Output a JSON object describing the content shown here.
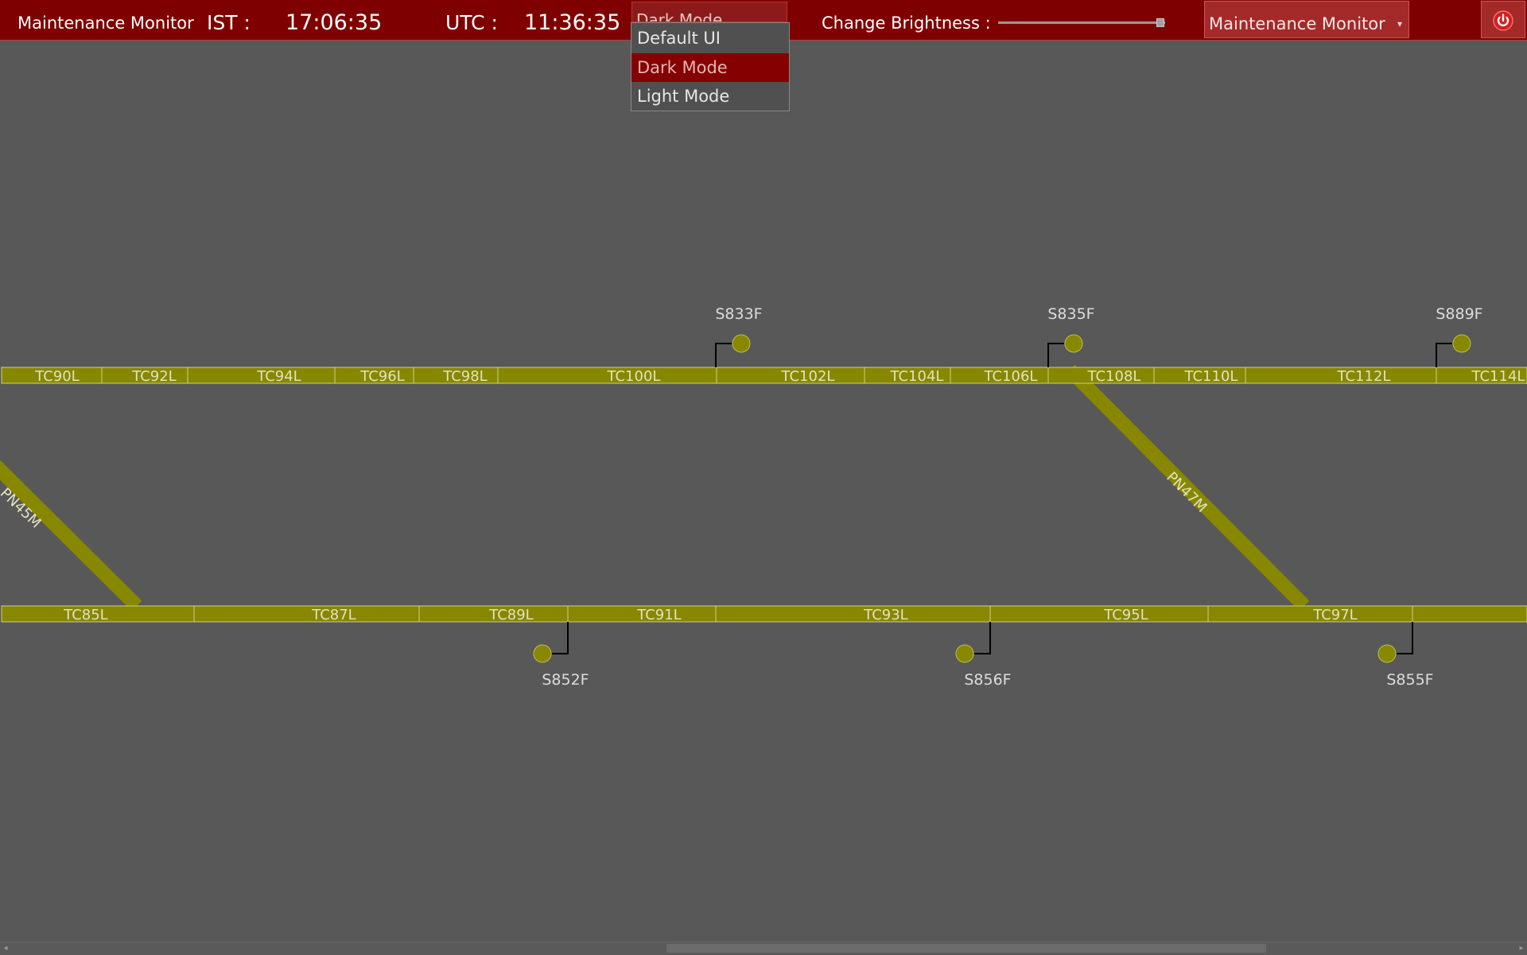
{
  "header": {
    "app_title": "Maintenance Monitor",
    "ist_label": "IST :",
    "ist_time": "17:06:35",
    "utc_label": "UTC :",
    "utc_time": "11:36:35",
    "mode_selected": "Dark Mode",
    "brightness_label": "Change Brightness :",
    "brightness_level": 0.97,
    "monitor_select": "Maintenance Monitor",
    "accent_color": "#7f0000"
  },
  "mode_menu": {
    "options": [
      "Default UI",
      "Dark Mode",
      "Light Mode"
    ],
    "selected": "Dark Mode"
  },
  "track_layout": {
    "track_color": "#878700",
    "upper_sections": [
      "TC90L",
      "TC92L",
      "TC94L",
      "TC96L",
      "TC98L",
      "TC100L",
      "TC102L",
      "TC104L",
      "TC106L",
      "TC108L",
      "TC110L",
      "TC112L",
      "TC114L"
    ],
    "lower_sections": [
      "TC85L",
      "TC87L",
      "TC89L",
      "TC91L",
      "TC93L",
      "TC95L",
      "TC97L"
    ],
    "points": [
      "PN45M",
      "PN47M"
    ],
    "signals_upper": [
      "S833F",
      "S835F",
      "S889F"
    ],
    "signals_lower": [
      "S852F",
      "S856F",
      "S855F"
    ]
  }
}
